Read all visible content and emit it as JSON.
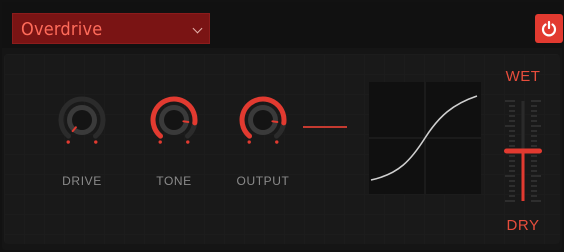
{
  "preset": {
    "name": "Overdrive"
  },
  "power": {
    "on": true
  },
  "knobs": [
    {
      "id": "drive",
      "label": "DRIVE",
      "value": 0.0
    },
    {
      "id": "tone",
      "label": "TONE",
      "value": 0.85
    },
    {
      "id": "output",
      "label": "OUTPUT",
      "value": 0.85
    }
  ],
  "mix": {
    "top_label": "WET",
    "bottom_label": "DRY",
    "value": 0.5
  },
  "colors": {
    "accent": "#e23a30",
    "accent_dark": "#7a1414",
    "knob_body": "#3a3a3a",
    "track": "#2b2b2b",
    "label": "#8a8a8a"
  }
}
